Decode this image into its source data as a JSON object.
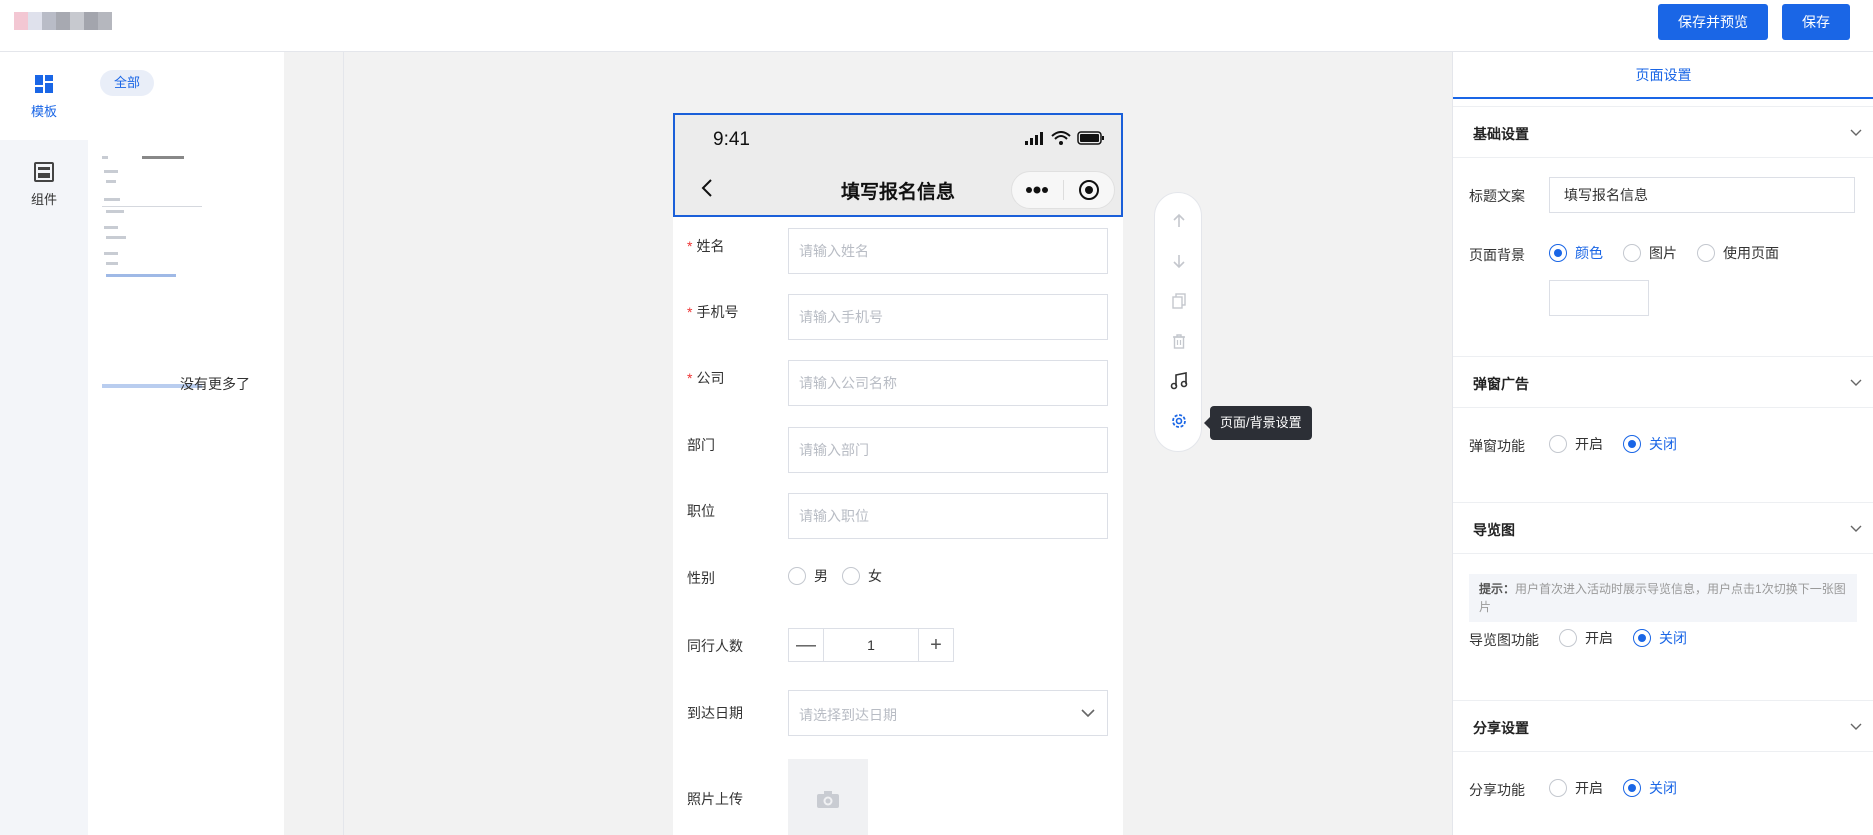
{
  "topbar": {
    "save_preview_label": "保存并预览",
    "save_label": "保存",
    "accent": "#1a66e6"
  },
  "leftnav": {
    "items": [
      {
        "label": "模板",
        "icon": "template-icon",
        "active": true
      },
      {
        "label": "组件",
        "icon": "component-icon",
        "active": false
      }
    ]
  },
  "templates": {
    "tab_all": "全部",
    "no_more": "没有更多了"
  },
  "phone": {
    "time": "9:41",
    "title": "填写报名信息",
    "fields": [
      {
        "label": "姓名",
        "required": true,
        "placeholder": "请输入姓名"
      },
      {
        "label": "手机号",
        "required": true,
        "placeholder": "请输入手机号"
      },
      {
        "label": "公司",
        "required": true,
        "placeholder": "请输入公司名称"
      },
      {
        "label": "部门",
        "required": false,
        "placeholder": "请输入部门"
      },
      {
        "label": "职位",
        "required": false,
        "placeholder": "请输入职位"
      }
    ],
    "gender": {
      "label": "性别",
      "options": [
        "男",
        "女"
      ]
    },
    "companions": {
      "label": "同行人数",
      "value": "1"
    },
    "arrival": {
      "label": "到达日期",
      "placeholder": "请选择到达日期"
    },
    "photo": {
      "label": "照片上传"
    }
  },
  "toolbar": {
    "tooltip": "页面/背景设置",
    "tools": [
      "arrow-up-icon",
      "arrow-down-icon",
      "copy-icon",
      "delete-icon",
      "music-icon",
      "settings-icon"
    ]
  },
  "settings": {
    "tab": "页面设置",
    "basic": {
      "heading": "基础设置",
      "title_label": "标题文案",
      "title_value": "填写报名信息",
      "bg_label": "页面背景",
      "bg_options": [
        "颜色",
        "图片",
        "使用页面"
      ],
      "bg_selected": "颜色"
    },
    "popup": {
      "heading": "弹窗广告",
      "label": "弹窗功能",
      "options": [
        "开启",
        "关闭"
      ],
      "selected": "关闭"
    },
    "guide": {
      "heading": "导览图",
      "hint_bold": "提示：",
      "hint_text": "用户首次进入活动时展示导览信息，用户点击1次切换下一张图片",
      "label": "导览图功能",
      "options": [
        "开启",
        "关闭"
      ],
      "selected": "关闭"
    },
    "share": {
      "heading": "分享设置",
      "label": "分享功能",
      "options": [
        "开启",
        "关闭"
      ],
      "selected": "关闭"
    }
  }
}
